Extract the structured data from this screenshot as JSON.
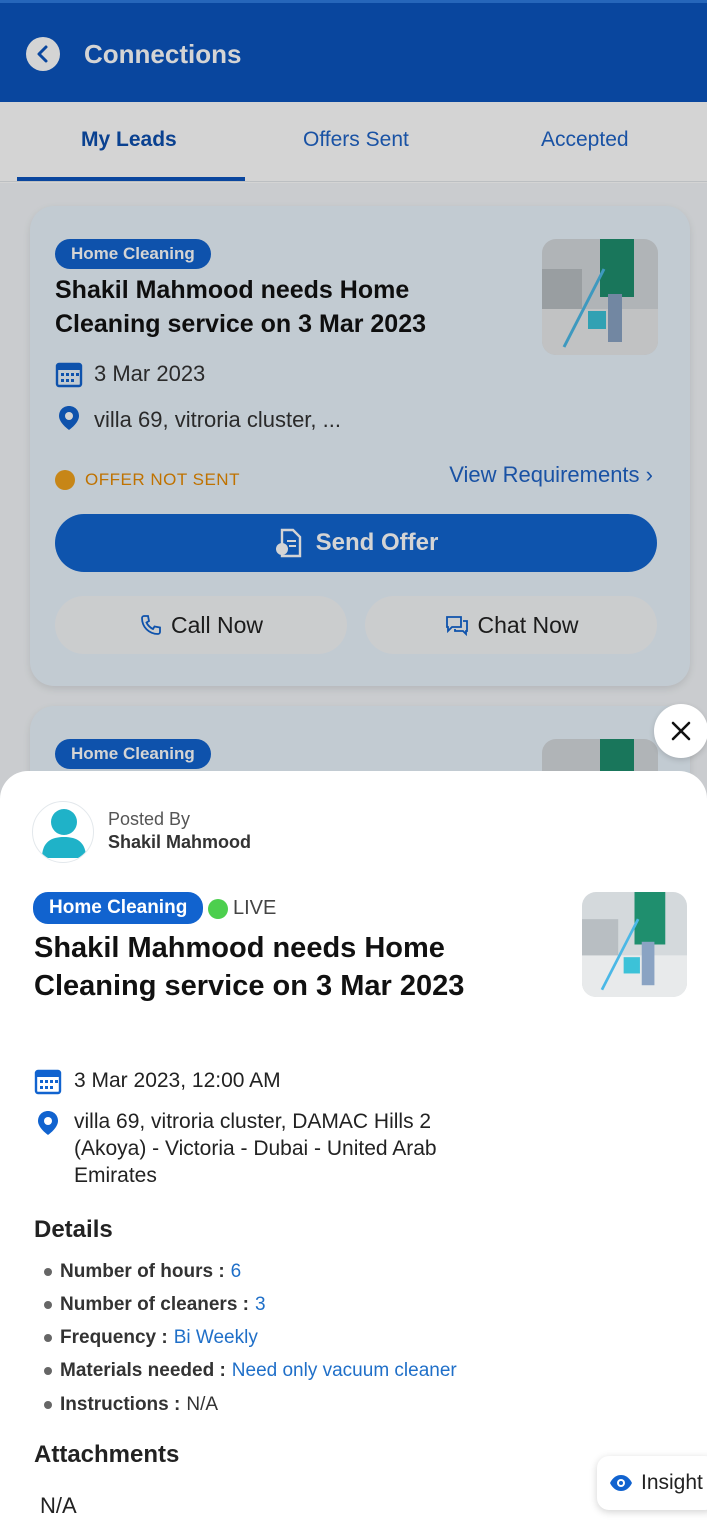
{
  "header": {
    "title": "Connections"
  },
  "tabs": [
    {
      "label": "My Leads",
      "active": true
    },
    {
      "label": "Offers Sent",
      "active": false
    },
    {
      "label": "Accepted",
      "active": false
    }
  ],
  "lead_card": {
    "category": "Home Cleaning",
    "title": "Shakil Mahmood needs Home Cleaning service on 3 Mar 2023",
    "date": "3 Mar 2023",
    "location": "villa 69, vitroria cluster, ...",
    "status": "OFFER NOT SENT",
    "view_requirements": "View Requirements",
    "send_offer": "Send Offer",
    "call_now": "Call Now",
    "chat_now": "Chat Now"
  },
  "next_card": {
    "category": "Home Cleaning"
  },
  "sheet": {
    "posted_by_label": "Posted By",
    "posted_by_name": "Shakil Mahmood",
    "category": "Home Cleaning",
    "live_label": "LIVE",
    "title": "Shakil Mahmood needs Home Cleaning service on 3 Mar 2023",
    "datetime": "3 Mar 2023, 12:00 AM",
    "address": "villa 69, vitroria cluster, DAMAC Hills 2 (Akoya) - Victoria - Dubai - United Arab Emirates",
    "details_heading": "Details",
    "details": [
      {
        "key": "Number of hours :",
        "value": "6"
      },
      {
        "key": "Number of cleaners :",
        "value": "3"
      },
      {
        "key": "Frequency :",
        "value": "Bi Weekly"
      },
      {
        "key": "Materials needed :",
        "value": "Need only vacuum cleaner"
      },
      {
        "key": "Instructions :",
        "value": "N/A"
      }
    ],
    "attachments_heading": "Attachments",
    "attachments_value": "N/A"
  },
  "insights_label": "Insight",
  "colors": {
    "primary": "#0c55bf",
    "accent": "#1165d1",
    "status_warn": "#f0a21c",
    "live": "#4ccf4e"
  }
}
